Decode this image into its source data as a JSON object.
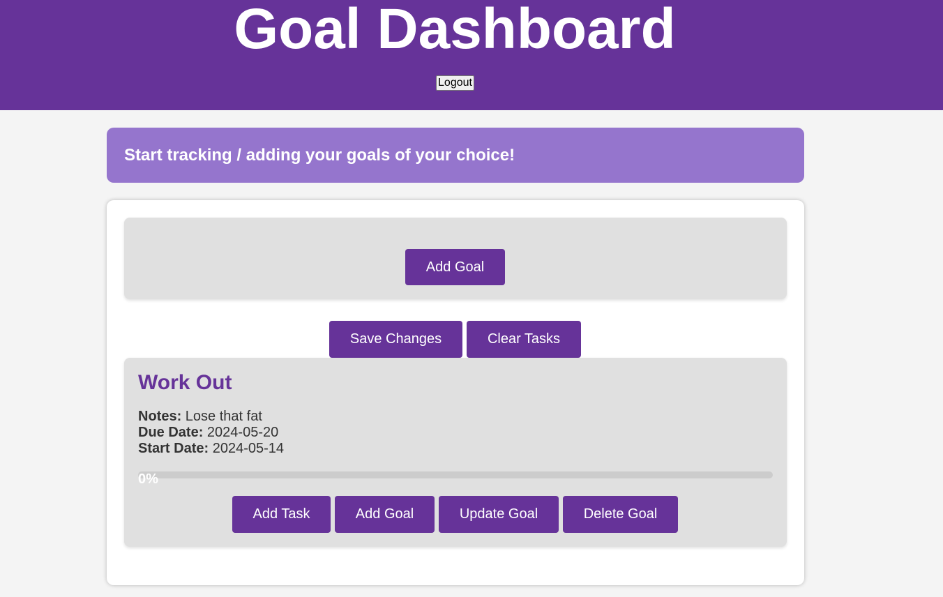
{
  "header": {
    "title": "Goal Dashboard",
    "logout_label": "Logout"
  },
  "banner": {
    "text": "Start tracking / adding your goals of your choice!"
  },
  "form_panel": {
    "add_goal_label": "Add Goal"
  },
  "actions": {
    "save_label": "Save Changes",
    "clear_label": "Clear Tasks"
  },
  "goal": {
    "title": "Work Out",
    "notes_label": "Notes:",
    "notes_value": "Lose that fat",
    "due_label": "Due Date:",
    "due_value": "2024-05-20",
    "start_label": "Start Date:",
    "start_value": "2024-05-14",
    "progress_value": 0,
    "progress_text": "0%",
    "buttons": {
      "add_task": "Add Task",
      "add_goal": "Add Goal",
      "update_goal": "Update Goal",
      "delete_goal": "Delete Goal"
    }
  },
  "colors": {
    "primary": "#663399",
    "banner": "#9575cd",
    "panel": "#e0e0e0",
    "background": "#f4f4f4"
  }
}
